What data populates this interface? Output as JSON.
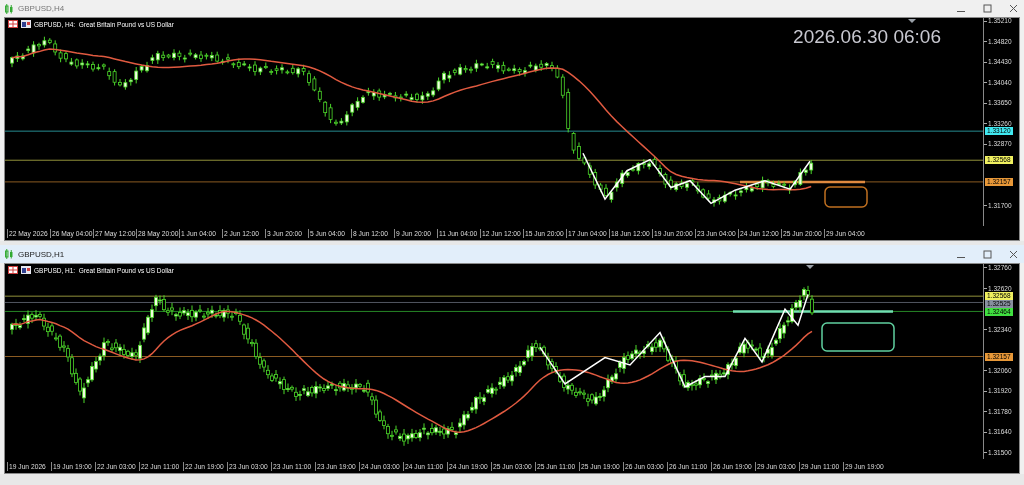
{
  "windows": [
    {
      "title": "GBPUSD,H4",
      "active": false,
      "chart": {
        "header": "GBPUSD, H4:  Great Britain Pound vs US Dollar",
        "clock": "2026.06.30 06:06",
        "price_ticks": [
          "1.35210",
          "1.34820",
          "1.34430",
          "1.34040",
          "1.33650",
          "1.33260",
          "1.32870",
          "1.31700"
        ],
        "price_lines": [
          {
            "label": "1.33120",
            "color": "#40e8f0"
          },
          {
            "label": "1.32568",
            "color": "#f0f060"
          },
          {
            "label": "1.32157",
            "color": "#e89838"
          }
        ],
        "time_labels": [
          "22 May 2026",
          "26 May 04:00",
          "27 May 12:00",
          "28 May 20:00",
          "1 Jun 04:00",
          "2 Jun 12:00",
          "3 Jun 20:00",
          "5 Jun 04:00",
          "8 Jun 12:00",
          "9 Jun 20:00",
          "11 Jun 04:00",
          "12 Jun 12:00",
          "15 Jun 20:00",
          "17 Jun 04:00",
          "18 Jun 12:00",
          "19 Jun 20:00",
          "23 Jun 04:00",
          "24 Jun 12:00",
          "25 Jun 20:00",
          "29 Jun 04:00"
        ]
      }
    },
    {
      "title": "GBPUSD,H1",
      "active": true,
      "chart": {
        "header": "GBPUSD, H1:  Great Britain Pound vs US Dollar",
        "price_ticks": [
          "1.32760",
          "1.32620",
          "1.32340",
          "1.32060",
          "1.31920",
          "1.31780",
          "1.31640",
          "1.31500"
        ],
        "price_lines": [
          {
            "label": "1.32568",
            "color": "#f0f060"
          },
          {
            "label": "1.32525",
            "color": "#8890a0"
          },
          {
            "label": "1.32464",
            "color": "#40e040"
          },
          {
            "label": "1.32157",
            "color": "#e89838"
          }
        ],
        "time_labels": [
          "19 Jun 2026",
          "19 Jun 19:00",
          "22 Jun 03:00",
          "22 Jun 11:00",
          "22 Jun 19:00",
          "23 Jun 03:00",
          "23 Jun 11:00",
          "23 Jun 19:00",
          "24 Jun 03:00",
          "24 Jun 11:00",
          "24 Jun 19:00",
          "25 Jun 03:00",
          "25 Jun 11:00",
          "25 Jun 19:00",
          "26 Jun 03:00",
          "26 Jun 11:00",
          "26 Jun 19:00",
          "29 Jun 03:00",
          "29 Jun 11:00",
          "29 Jun 19:00"
        ]
      }
    }
  ]
}
